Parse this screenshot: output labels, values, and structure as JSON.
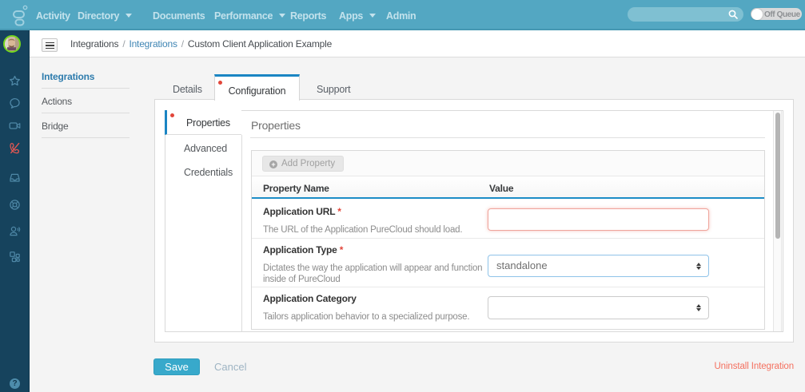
{
  "topbar": {
    "nav": [
      {
        "label": "Activity",
        "has_menu": false
      },
      {
        "label": "Directory",
        "has_menu": true
      },
      {
        "label": "Documents",
        "has_menu": false
      },
      {
        "label": "Performance",
        "has_menu": true
      },
      {
        "label": "Reports",
        "has_menu": false
      },
      {
        "label": "Apps",
        "has_menu": true
      },
      {
        "label": "Admin",
        "has_menu": false
      }
    ],
    "search": {
      "placeholder": "",
      "value": ""
    },
    "queue_toggle": {
      "label": "Off Queue",
      "state": "off"
    }
  },
  "rail": {
    "icons": [
      "star-icon",
      "chat-icon",
      "video-icon",
      "phone-disabled-icon",
      "inbox-icon",
      "lifering-icon",
      "contact-sound-icon",
      "apps-icon"
    ],
    "phone_disabled_color": "#e25752",
    "help_label": "?"
  },
  "breadcrumb": {
    "separator": "/",
    "segments": [
      {
        "label": "Integrations",
        "link": false
      },
      {
        "label": "Integrations",
        "link": true
      },
      {
        "label": "Custom Client Application Example",
        "link": false
      }
    ]
  },
  "sidebar": {
    "items": [
      {
        "label": "Integrations",
        "active": true
      },
      {
        "label": "Actions",
        "active": false
      },
      {
        "label": "Bridge",
        "active": false
      }
    ]
  },
  "tabs": {
    "items": [
      {
        "label": "Details",
        "active": false,
        "modified": false
      },
      {
        "label": "Configuration",
        "active": true,
        "modified": true
      },
      {
        "label": "Support",
        "active": false,
        "modified": false
      }
    ]
  },
  "config_tabs": {
    "items": [
      {
        "label": "Properties",
        "active": true,
        "modified": true
      },
      {
        "label": "Advanced",
        "active": false,
        "modified": false
      },
      {
        "label": "Credentials",
        "active": false,
        "modified": false
      }
    ]
  },
  "properties_panel": {
    "heading": "Properties",
    "add_button": {
      "label": "Add Property",
      "disabled": true
    },
    "table": {
      "columns": [
        "Property Name",
        "Value"
      ],
      "rows": [
        {
          "name": "Application URL",
          "required": "*",
          "description": "The URL of the Application PureCloud should load.",
          "control": "text-input",
          "value": "",
          "state": "error"
        },
        {
          "name": "Application Type",
          "required": "*",
          "description": "Dictates the way the application will appear and function inside of PureCloud",
          "control": "select",
          "value": "standalone",
          "state": "focused"
        },
        {
          "name": "Application Category",
          "required": "",
          "description": "Tailors application behavior to a specialized purpose.",
          "control": "select",
          "value": "",
          "state": "normal"
        }
      ]
    }
  },
  "actions": {
    "save_label": "Save",
    "cancel_label": "Cancel",
    "uninstall_label": "Uninstall Integration"
  },
  "colors": {
    "topbar": "#53a7c2",
    "rail": "#16435d",
    "accent_blue": "#1a85c3",
    "link_blue": "#4086b4",
    "active_item_blue": "#2e7cad",
    "error_red": "#e2463a",
    "save_teal": "#38a9cb",
    "uninstall_salmon": "#f4705f",
    "avatar_ring_green": "#74d61c",
    "page_bg": "#f4f4f4"
  }
}
